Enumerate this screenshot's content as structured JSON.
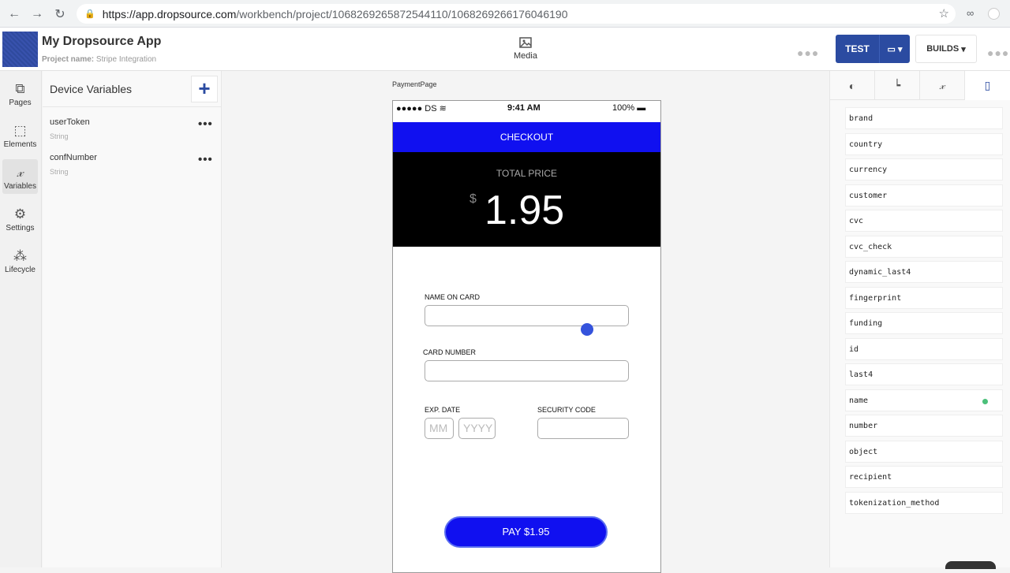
{
  "browser": {
    "url_host": "https://app.dropsource.com",
    "url_path": "/workbench/project/1068269265872544110/1068269266176046190"
  },
  "header": {
    "app_title": "My Dropsource App",
    "project_label": "Project name:",
    "project_name": "Stripe Integration",
    "media_label": "Media",
    "test_label": "TEST",
    "builds_label": "BUILDS"
  },
  "rail": {
    "pages": "Pages",
    "elements": "Elements",
    "variables": "Variables",
    "settings": "Settings",
    "lifecycle": "Lifecycle"
  },
  "variables_panel": {
    "title": "Device Variables",
    "items": [
      {
        "name": "userToken",
        "type": "String"
      },
      {
        "name": "confNumber",
        "type": "String"
      }
    ]
  },
  "canvas": {
    "page_name": "PaymentPage",
    "status": {
      "carrier": "●●●●● DS",
      "time": "9:41 AM",
      "battery": "100%"
    },
    "checkout_title": "CHECKOUT",
    "total_label": "TOTAL PRICE",
    "currency": "$",
    "amount": "1.95",
    "name_label": "NAME ON CARD",
    "card_label": "CARD NUMBER",
    "exp_label": "EXP. DATE",
    "mm_placeholder": "MM",
    "yyyy_placeholder": "YYYY",
    "security_label": "SECURITY CODE",
    "pay_label": "PAY $1.95"
  },
  "properties": [
    "brand",
    "country",
    "currency",
    "customer",
    "cvc",
    "cvc_check",
    "dynamic_last4",
    "fingerprint",
    "funding",
    "id",
    "last4",
    "name",
    "number",
    "object",
    "recipient",
    "tokenization_method"
  ],
  "colors": {
    "accent": "#2b4ba1",
    "checkout_blue": "#1010f0",
    "status_dot": "#4cc07a"
  }
}
